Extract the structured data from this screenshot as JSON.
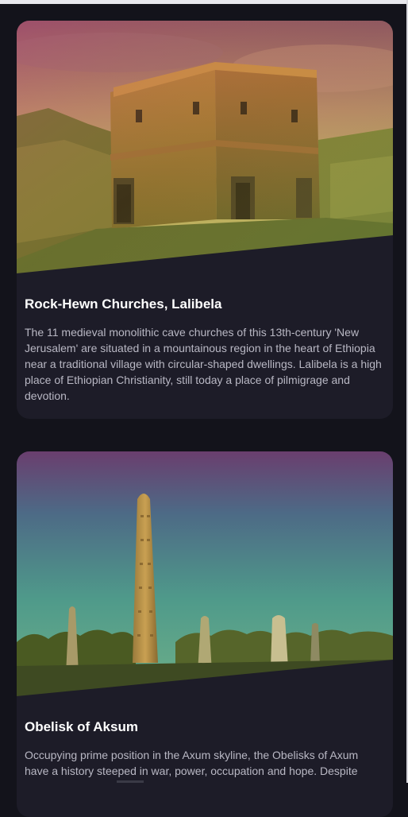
{
  "cards": [
    {
      "title": "Rock-Hewn Churches, Lalibela",
      "description": "The 11 medieval monolithic cave churches of this 13th-century 'New Jerusalem' are situated in a mountainous region in the heart of Ethiopia near a traditional village with circular-shaped dwellings. Lalibela is a high place of Ethiopian Christianity, still today a place of pilmigrage and devotion.",
      "image": "rock-hewn-church-photo"
    },
    {
      "title": "Obelisk of Aksum",
      "description": "Occupying prime position in the Axum skyline, the Obelisks of Axum have a history steeped in war, power, occupation and hope. Despite",
      "image": "obelisk-photo"
    }
  ],
  "colors": {
    "page_background": "#13131b",
    "card_background": "#1d1c28",
    "title": "#ffffff",
    "body_text": "#b9b8c4"
  }
}
